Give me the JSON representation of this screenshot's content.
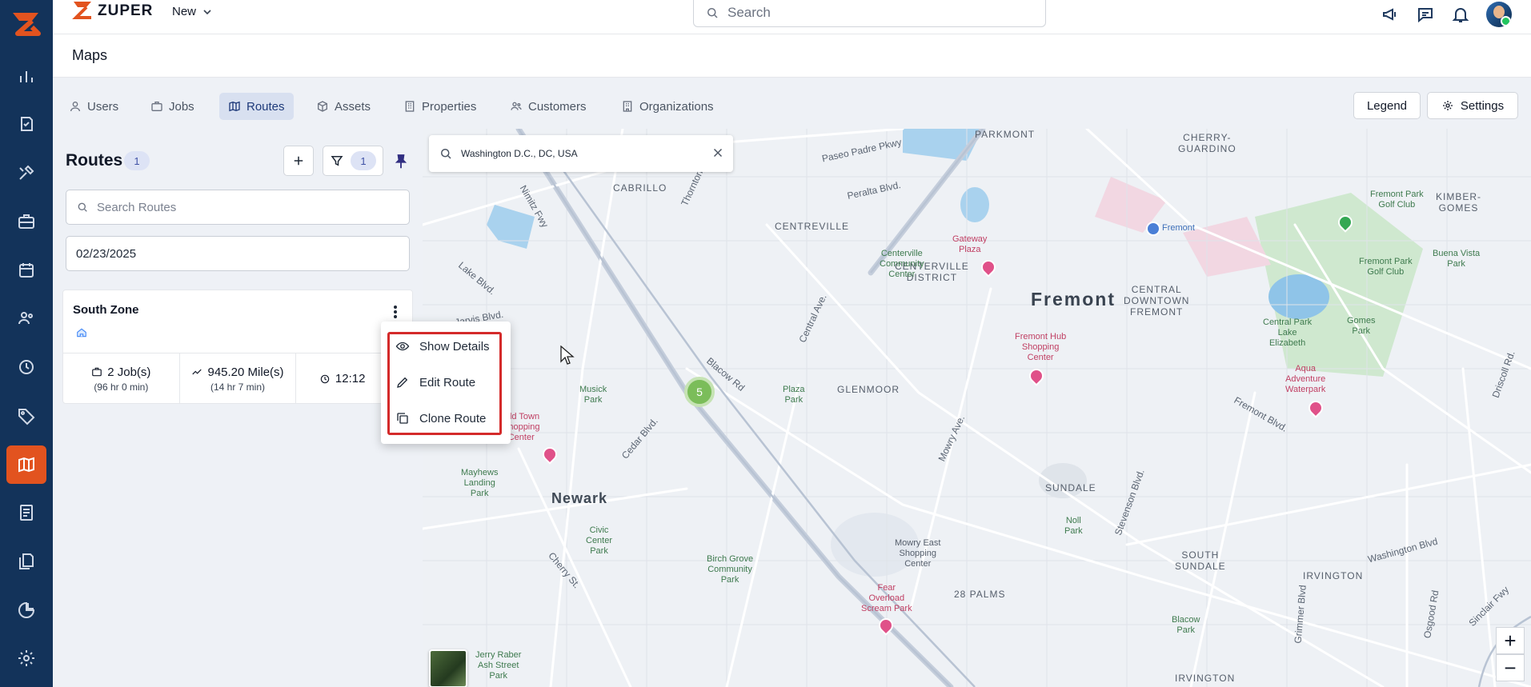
{
  "app": {
    "brand": "ZUPER",
    "new_label": "New",
    "search_placeholder": "Search"
  },
  "page": {
    "title": "Maps"
  },
  "tabs": [
    {
      "label": "Users",
      "icon": "user-icon",
      "active": false
    },
    {
      "label": "Jobs",
      "icon": "briefcase-icon",
      "active": false
    },
    {
      "label": "Routes",
      "icon": "map-icon",
      "active": true
    },
    {
      "label": "Assets",
      "icon": "box-icon",
      "active": false
    },
    {
      "label": "Properties",
      "icon": "building-icon",
      "active": false
    },
    {
      "label": "Customers",
      "icon": "users-icon",
      "active": false
    },
    {
      "label": "Organizations",
      "icon": "building-icon",
      "active": false
    }
  ],
  "toolbar": {
    "legend_label": "Legend",
    "settings_label": "Settings"
  },
  "routes_panel": {
    "title": "Routes",
    "count": "1",
    "filter_count": "1",
    "search_placeholder": "Search Routes",
    "date_value": "02/23/2025"
  },
  "route_card": {
    "name": "South Zone",
    "jobs": "2 Job(s)",
    "jobs_duration": "(96 hr 0 min)",
    "distance": "945.20 Mile(s)",
    "distance_duration": "(14 hr 7 min)",
    "time": "12:12"
  },
  "context_menu": {
    "items": [
      {
        "label": "Show Details",
        "icon": "eye-icon"
      },
      {
        "label": "Edit Route",
        "icon": "pencil-icon"
      },
      {
        "label": "Clone Route",
        "icon": "copy-icon"
      }
    ],
    "highlight_color": "#d42a2a"
  },
  "map": {
    "search_value": "Washington D.C., DC, USA",
    "cluster_count": "5",
    "zoom_in": "+",
    "zoom_out": "−",
    "labels": {
      "parkmont": "PARKMONT",
      "cherry_guardino": "CHERRY-\nGUARDINO",
      "cabrillo": "CABRILLO",
      "centreville": "CENTREVILLE",
      "centerville_district": "CENTERVILLE\nDISTRICT",
      "fremont": "Fremont",
      "central_downtown": "CENTRAL\nDOWNTOWN\nFREMONT",
      "kimber_gomes": "KIMBER-\nGOMES",
      "glenmoor": "GLENMOOR",
      "newark": "Newark",
      "sundale": "SUNDALE",
      "south_sundale": "SOUTH\nSUNDALE",
      "irvington": "IRVINGTON",
      "irvington2": "IRVINGTON",
      "palms": "28 PALMS",
      "gateway_plaza": "Gateway\nPlaza",
      "fremont_hub": "Fremont Hub\nShopping\nCenter",
      "old_town": "Old Town\nShopping\nCenter",
      "aqua_adventure": "Aqua\nAdventure\nWaterpark",
      "fear_scream": "Fear\nOverload\nScream Park",
      "fremont_poi": "Fremont",
      "fremont_park_golf": "Fremont Park\nGolf Club",
      "fremont_park_golf2": "Fremont Park\nGolf Club",
      "central_park_lake": "Central Park\nLake\nElizabeth",
      "gomes_park": "Gomes\nPark",
      "buena_vista": "Buena Vista\nPark",
      "centerville_cc": "Centerville\nCommunity\nCenter",
      "musick_park": "Musick\nPark",
      "plaza_park": "Plaza\nPark",
      "mayhews": "Mayhews\nLanding\nPark",
      "civic_center": "Civic\nCenter\nPark",
      "birch_grove": "Birch Grove\nCommunity\nPark",
      "mowry_east": "Mowry East\nShopping\nCenter",
      "noll_park": "Noll\nPark",
      "blacow_park": "Blacow\nPark",
      "jerry_raber": "Jerry Raber\nAsh Street\nPark",
      "paseo_padre_1": "Paseo Padre Pkwy",
      "peralta": "Peralta Blvd.",
      "nimitz": "Nimitz Fwy",
      "thornton": "Thornton Ave.",
      "blacow_rd": "Blacow Rd",
      "fremont_blvd": "Fremont Blvd.",
      "central_ave": "Central Ave.",
      "mowry_ave": "Mowry Ave.",
      "cedar_blvd": "Cedar Blvd.",
      "cherry_st": "Cherry St.",
      "washington_blvd": "Washington Blvd",
      "stevenson_blvd": "Stevenson Blvd.",
      "grimmer_blvd": "Grimmer Blvd",
      "osgood_rd": "Osgood Rd",
      "sinclair_fwy": "Sinclair Fwy",
      "driscoll_rd": "Driscoll Rd.",
      "lake_blvd": "Lake Blvd.",
      "jarvis": "Jarvis Blvd."
    }
  }
}
